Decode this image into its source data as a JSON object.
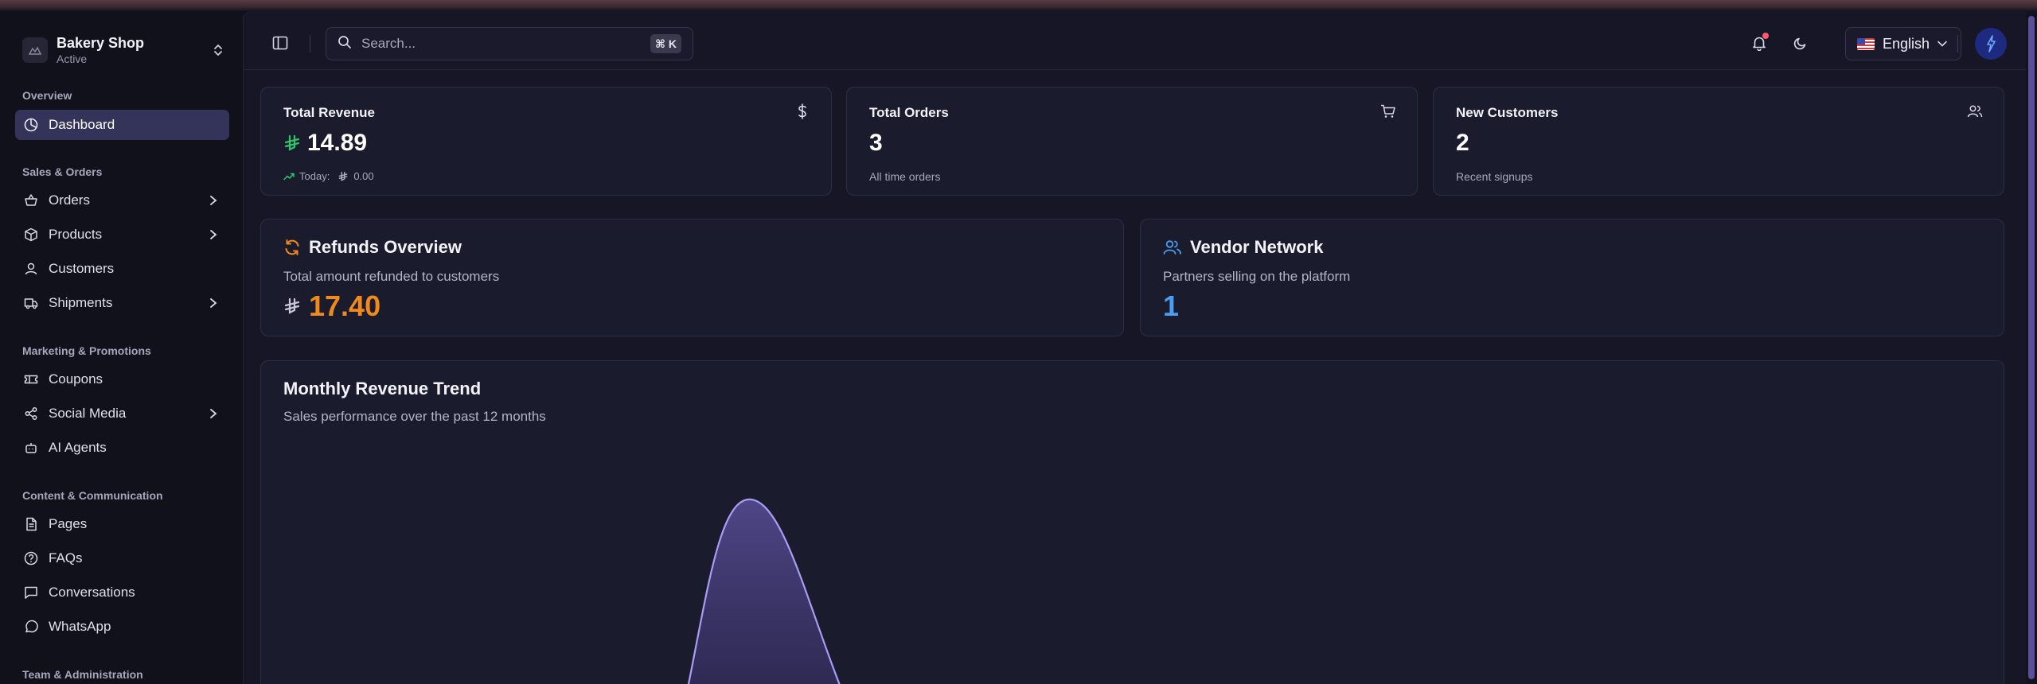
{
  "brand": {
    "name": "Bakery Shop",
    "status": "Active"
  },
  "sidebar": {
    "sections": [
      {
        "title": "Overview",
        "items": [
          {
            "label": "Dashboard",
            "icon": "dashboard-icon",
            "active": true
          }
        ]
      },
      {
        "title": "Sales & Orders",
        "items": [
          {
            "label": "Orders",
            "icon": "basket-icon",
            "chevron": true
          },
          {
            "label": "Products",
            "icon": "box-icon",
            "chevron": true
          },
          {
            "label": "Customers",
            "icon": "user-icon"
          },
          {
            "label": "Shipments",
            "icon": "truck-icon",
            "chevron": true
          }
        ]
      },
      {
        "title": "Marketing & Promotions",
        "items": [
          {
            "label": "Coupons",
            "icon": "ticket-icon"
          },
          {
            "label": "Social Media",
            "icon": "share-icon",
            "chevron": true
          },
          {
            "label": "AI Agents",
            "icon": "bot-icon"
          }
        ]
      },
      {
        "title": "Content & Communication",
        "items": [
          {
            "label": "Pages",
            "icon": "file-icon"
          },
          {
            "label": "FAQs",
            "icon": "help-circle-icon"
          },
          {
            "label": "Conversations",
            "icon": "chat-icon"
          },
          {
            "label": "WhatsApp",
            "icon": "whatsapp-icon"
          }
        ]
      },
      {
        "title": "Team & Administration",
        "items": []
      }
    ]
  },
  "header": {
    "search_placeholder": "Search...",
    "search_shortcut": "⌘ K",
    "language": "English"
  },
  "stats": {
    "revenue": {
      "title": "Total Revenue",
      "value": "14.89",
      "today_label": "Today:",
      "today_value": "0.00"
    },
    "orders": {
      "title": "Total Orders",
      "value": "3",
      "sub": "All time orders"
    },
    "customers": {
      "title": "New Customers",
      "value": "2",
      "sub": "Recent signups"
    }
  },
  "refunds": {
    "title": "Refunds Overview",
    "desc": "Total amount refunded to customers",
    "value": "17.40"
  },
  "vendors": {
    "title": "Vendor Network",
    "desc": "Partners selling on the platform",
    "value": "1"
  },
  "trend": {
    "title": "Monthly Revenue Trend",
    "subtitle": "Sales performance over the past 12 months"
  },
  "colors": {
    "accent": "#8a7ee0",
    "refund": "#f08a1c",
    "vendor": "#4a9ef0",
    "positive": "#2fc46a",
    "notif": "#ff5a6e"
  }
}
